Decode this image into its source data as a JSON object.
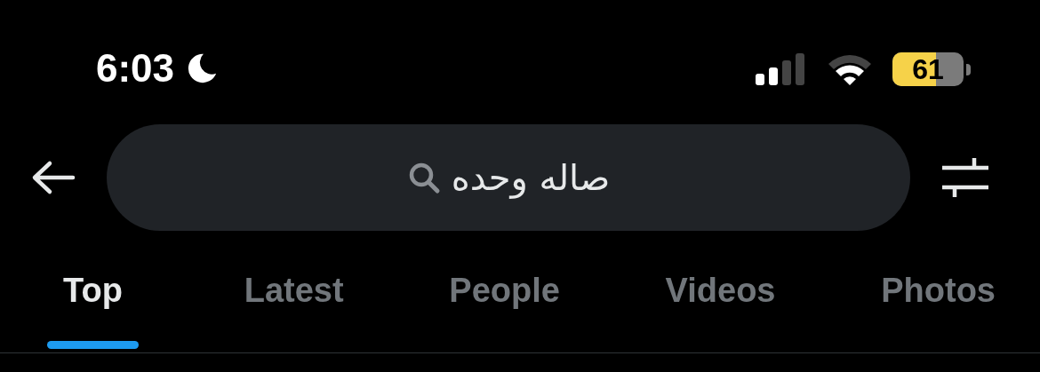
{
  "status_bar": {
    "time": "6:03",
    "battery": "61"
  },
  "search": {
    "value": "صاله وحده"
  },
  "tabs": [
    {
      "label": "Top",
      "selected": true
    },
    {
      "label": "Latest",
      "selected": false
    },
    {
      "label": "People",
      "selected": false
    },
    {
      "label": "Videos",
      "selected": false
    },
    {
      "label": "Photos",
      "selected": false
    }
  ]
}
